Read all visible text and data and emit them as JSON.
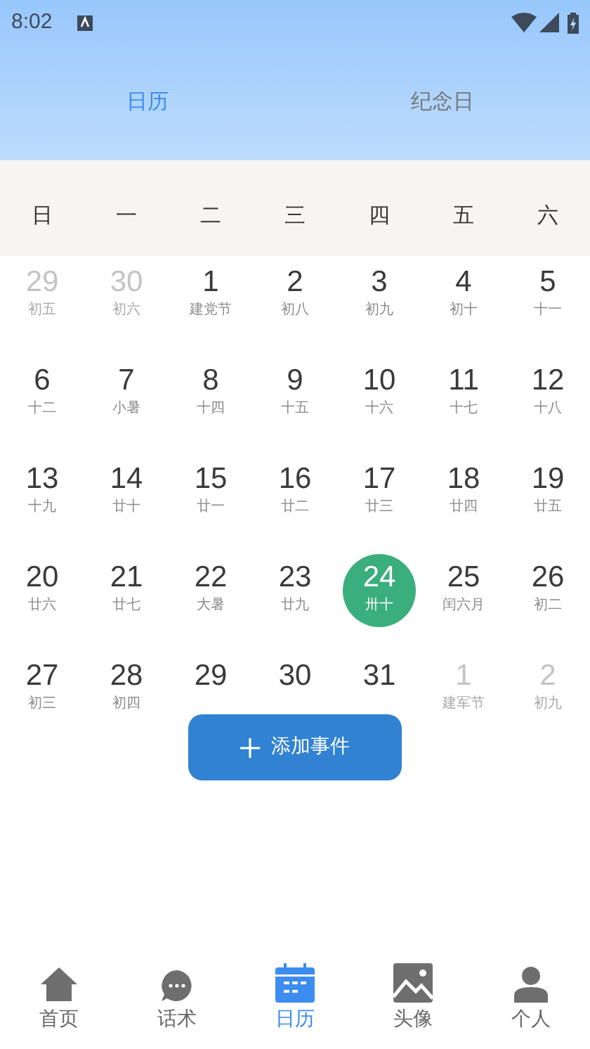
{
  "status_bar": {
    "time": "8:02"
  },
  "tabs": [
    {
      "label": "日历",
      "selected": true
    },
    {
      "label": "纪念日",
      "selected": false
    }
  ],
  "weekdays": [
    "日",
    "一",
    "二",
    "三",
    "四",
    "五",
    "六"
  ],
  "days": [
    {
      "day": "29",
      "lunar": "初五",
      "other_month": true,
      "selected": false
    },
    {
      "day": "30",
      "lunar": "初六",
      "other_month": true,
      "selected": false
    },
    {
      "day": "1",
      "lunar": "建党节",
      "other_month": false,
      "selected": false
    },
    {
      "day": "2",
      "lunar": "初八",
      "other_month": false,
      "selected": false
    },
    {
      "day": "3",
      "lunar": "初九",
      "other_month": false,
      "selected": false
    },
    {
      "day": "4",
      "lunar": "初十",
      "other_month": false,
      "selected": false
    },
    {
      "day": "5",
      "lunar": "十一",
      "other_month": false,
      "selected": false
    },
    {
      "day": "6",
      "lunar": "十二",
      "other_month": false,
      "selected": false
    },
    {
      "day": "7",
      "lunar": "小暑",
      "other_month": false,
      "selected": false
    },
    {
      "day": "8",
      "lunar": "十四",
      "other_month": false,
      "selected": false
    },
    {
      "day": "9",
      "lunar": "十五",
      "other_month": false,
      "selected": false
    },
    {
      "day": "10",
      "lunar": "十六",
      "other_month": false,
      "selected": false
    },
    {
      "day": "11",
      "lunar": "十七",
      "other_month": false,
      "selected": false
    },
    {
      "day": "12",
      "lunar": "十八",
      "other_month": false,
      "selected": false
    },
    {
      "day": "13",
      "lunar": "十九",
      "other_month": false,
      "selected": false
    },
    {
      "day": "14",
      "lunar": "廿十",
      "other_month": false,
      "selected": false
    },
    {
      "day": "15",
      "lunar": "廿一",
      "other_month": false,
      "selected": false
    },
    {
      "day": "16",
      "lunar": "廿二",
      "other_month": false,
      "selected": false
    },
    {
      "day": "17",
      "lunar": "廿三",
      "other_month": false,
      "selected": false
    },
    {
      "day": "18",
      "lunar": "廿四",
      "other_month": false,
      "selected": false
    },
    {
      "day": "19",
      "lunar": "廿五",
      "other_month": false,
      "selected": false
    },
    {
      "day": "20",
      "lunar": "廿六",
      "other_month": false,
      "selected": false
    },
    {
      "day": "21",
      "lunar": "廿七",
      "other_month": false,
      "selected": false
    },
    {
      "day": "22",
      "lunar": "大暑",
      "other_month": false,
      "selected": false
    },
    {
      "day": "23",
      "lunar": "廿九",
      "other_month": false,
      "selected": false
    },
    {
      "day": "24",
      "lunar": "卅十",
      "other_month": false,
      "selected": true
    },
    {
      "day": "25",
      "lunar": "闰六月",
      "other_month": false,
      "selected": false
    },
    {
      "day": "26",
      "lunar": "初二",
      "other_month": false,
      "selected": false
    },
    {
      "day": "27",
      "lunar": "初三",
      "other_month": false,
      "selected": false
    },
    {
      "day": "28",
      "lunar": "初四",
      "other_month": false,
      "selected": false
    },
    {
      "day": "29",
      "other_month": false,
      "selected": false
    },
    {
      "day": "30",
      "other_month": false,
      "selected": false
    },
    {
      "day": "31",
      "other_month": false,
      "selected": false
    },
    {
      "day": "1",
      "lunar": "建军节",
      "other_month": true,
      "selected": false
    },
    {
      "day": "2",
      "lunar": "初九",
      "other_month": true,
      "selected": false
    }
  ],
  "add_button": {
    "label": "添加事件"
  },
  "nav": [
    {
      "kind": "home",
      "label": "首页",
      "selected": false
    },
    {
      "kind": "chat",
      "label": "话术",
      "selected": false
    },
    {
      "kind": "calendar",
      "label": "日历",
      "selected": true
    },
    {
      "kind": "image",
      "label": "头像",
      "selected": false
    },
    {
      "kind": "person",
      "label": "个人",
      "selected": false
    }
  ]
}
